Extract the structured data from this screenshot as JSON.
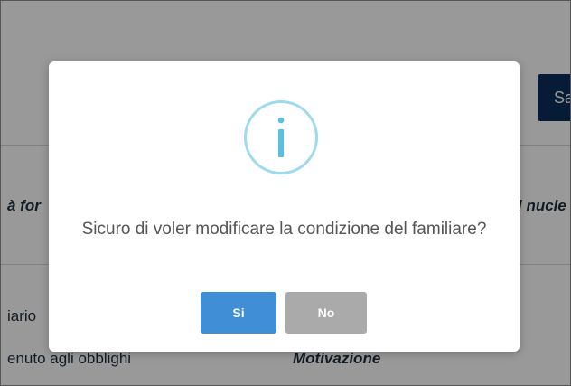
{
  "background": {
    "save_button_label": "Sa",
    "column_left_header": "à for",
    "column_right_header": "l nucle",
    "row1_left": "iario",
    "row2_left": "enuto agli obblighi",
    "row2_right": "Motivazione"
  },
  "dialog": {
    "icon": "info-icon",
    "icon_glyph": "i",
    "icon_color": "#5bc0de",
    "message": "Sicuro di voler modificare la condizione del familiare?",
    "confirm_label": "Si",
    "cancel_label": "No",
    "confirm_color": "#3f8ed6",
    "cancel_color": "#aaaaaa"
  }
}
